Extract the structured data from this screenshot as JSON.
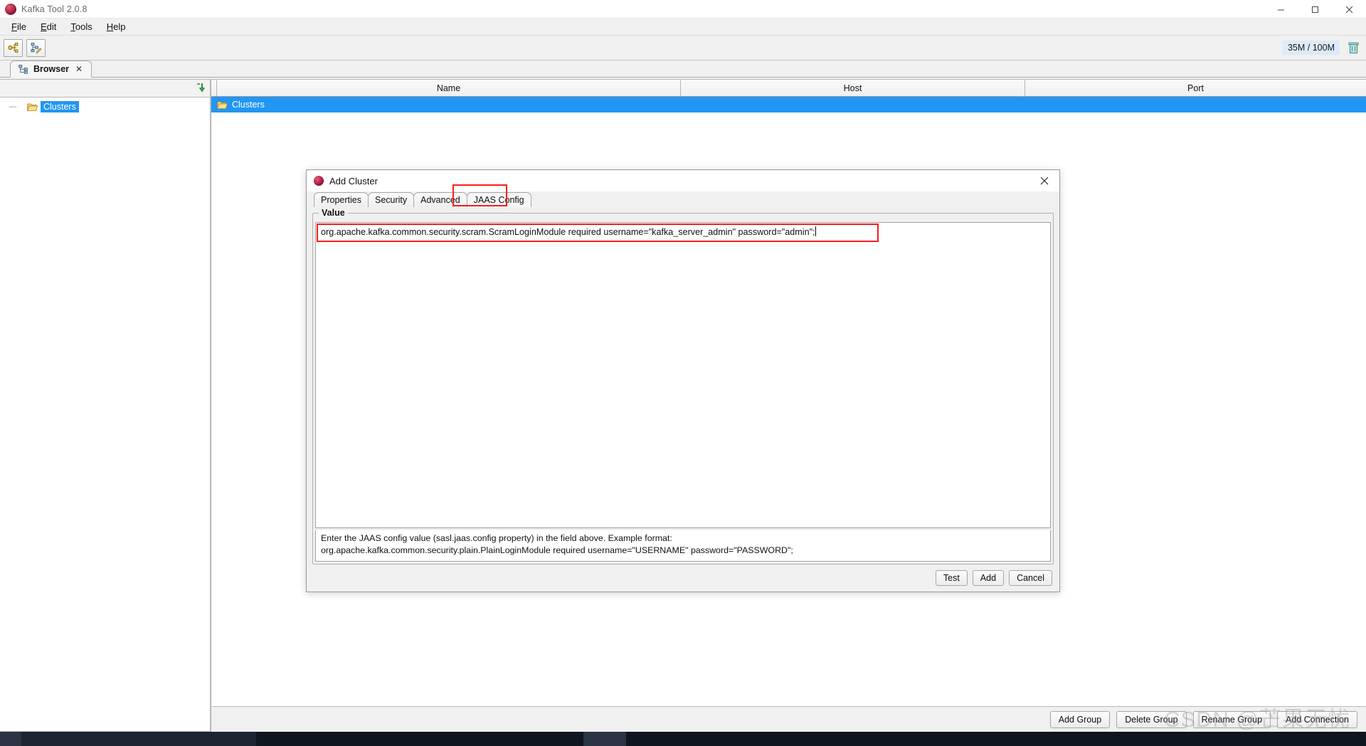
{
  "window": {
    "title": "Kafka Tool  2.0.8",
    "app_icon": "kafka-tool-icon",
    "buttons": {
      "minimize": "–",
      "maximize": "❐",
      "close": "✕"
    }
  },
  "menubar": {
    "items": [
      {
        "label": "File",
        "mnemonic": "F"
      },
      {
        "label": "Edit",
        "mnemonic": "E"
      },
      {
        "label": "Tools",
        "mnemonic": "T"
      },
      {
        "label": "Help",
        "mnemonic": "H"
      }
    ]
  },
  "toolbar": {
    "buttons": [
      {
        "name": "add-cluster-toolbar-button",
        "icon": "cluster-add-icon"
      },
      {
        "name": "edit-tree-toolbar-button",
        "icon": "tree-edit-icon"
      }
    ],
    "memory": {
      "label": "35M / 100M",
      "trash_icon": "trash-icon"
    }
  },
  "tabstrip": {
    "tabs": [
      {
        "label": "Browser",
        "icon": "browser-tree-icon",
        "close": "✕",
        "active": true
      }
    ]
  },
  "tree": {
    "collapse_icon": "collapse-all-icon",
    "nodes": [
      {
        "label": "Clusters",
        "icon": "folder-open-icon",
        "selected": true
      }
    ]
  },
  "table": {
    "columns": [
      "",
      "Name",
      "Host",
      "Port"
    ],
    "rows": [
      {
        "name": "Clusters",
        "host": "",
        "port": "",
        "icon": "folder-open-icon",
        "selected": true
      }
    ]
  },
  "bottom_actions": [
    {
      "label": "Add Group",
      "name": "add-group-button"
    },
    {
      "label": "Delete Group",
      "name": "delete-group-button"
    },
    {
      "label": "Rename Group",
      "name": "rename-group-button"
    },
    {
      "label": "Add Connection",
      "name": "add-connection-button"
    }
  ],
  "dialog": {
    "title": "Add Cluster",
    "icon": "kafka-tool-icon",
    "close": "✕",
    "tabs": [
      {
        "label": "Properties",
        "active": false
      },
      {
        "label": "Security",
        "active": false
      },
      {
        "label": "Advanced",
        "active": false
      },
      {
        "label": "JAAS Config",
        "active": true,
        "highlighted": true
      }
    ],
    "group_legend": "Value",
    "value_field": {
      "value": "org.apache.kafka.common.security.scram.ScramLoginModule required username=\"kafka_server_admin\" password=\"admin\";",
      "placeholder": "",
      "highlighted": true
    },
    "hint": {
      "line1": "Enter the JAAS config value (sasl.jaas.config property) in the field above. Example format:",
      "line2": "org.apache.kafka.common.security.plain.PlainLoginModule required username=\"USERNAME\" password=\"PASSWORD\";"
    },
    "buttons": [
      {
        "label": "Test",
        "name": "test-button"
      },
      {
        "label": "Add",
        "name": "add-button"
      },
      {
        "label": "Cancel",
        "name": "cancel-button"
      }
    ]
  },
  "watermark": "CSDN @芒果无忧",
  "colors": {
    "selection_blue": "#2196f3",
    "highlight_red": "#f81d1d",
    "window_bg": "#f0f0f0",
    "taskbar": "#1b2430"
  }
}
